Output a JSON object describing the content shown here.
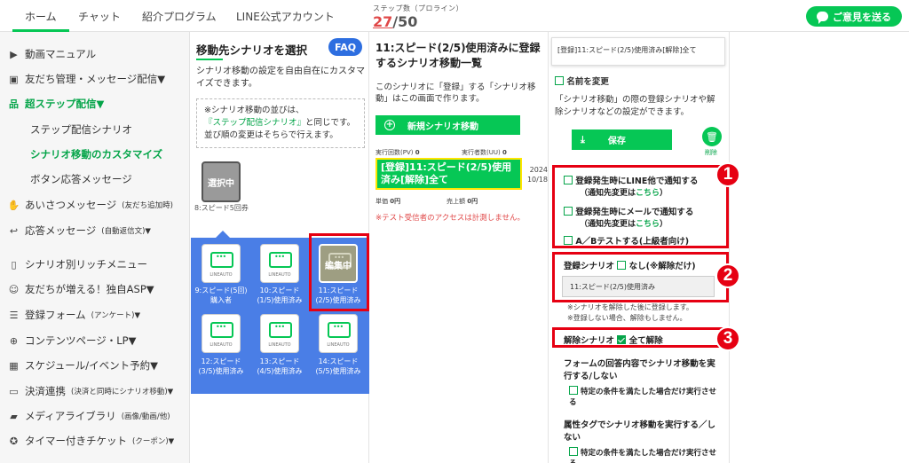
{
  "nav": {
    "tabs": [
      {
        "label": "ホーム"
      },
      {
        "label": "チャット"
      },
      {
        "label": "紹介プログラム"
      },
      {
        "label": "LINE公式アカウント"
      }
    ],
    "step_label": "ステップ数（プロライン）",
    "step_current": "27",
    "step_total": "/50",
    "feedback_label": "ご意見を送る"
  },
  "sidebar": {
    "items": [
      {
        "icon": "video-icon",
        "label": "動画マニュアル"
      },
      {
        "icon": "user-icon",
        "label": "友だち管理・メッセージ配信▼"
      },
      {
        "icon": "sitemap-icon",
        "label": "超ステップ配信▼"
      },
      {
        "icon": "hand-icon",
        "label": "あいさつメッセージ",
        "small": "(友だち追加時)"
      },
      {
        "icon": "reply-icon",
        "label": "応答メッセージ",
        "small": "(自動返信文)▼"
      },
      {
        "icon": "mobile-icon",
        "label": "シナリオ別リッチメニュー"
      },
      {
        "icon": "friends-icon",
        "label": "友だちが増える！独自ASP▼"
      },
      {
        "icon": "list-icon",
        "label": "登録フォーム",
        "small": "(アンケート)▼"
      },
      {
        "icon": "globe-icon",
        "label": "コンテンツページ・LP▼"
      },
      {
        "icon": "calendar-icon",
        "label": "スケジュール/イベント予約▼"
      },
      {
        "icon": "card-icon",
        "label": "決済連携",
        "small": "(決済と同時にシナリオ移動)▼"
      },
      {
        "icon": "folder-icon",
        "label": "メディアライブラリ",
        "small": "(画像/動画/他)"
      },
      {
        "icon": "ticket-icon",
        "label": "タイマー付きチケット",
        "small": "(クーポン)▼"
      }
    ],
    "sub_items": [
      {
        "label": "ステップ配信シナリオ"
      },
      {
        "label": "シナリオ移動のカスタマイズ"
      },
      {
        "label": "ボタン応答メッセージ"
      }
    ]
  },
  "col1": {
    "title": "移動先シナリオを選択",
    "faq_label": "FAQ",
    "desc": "シナリオ移動の設定を自由自在にカスタマイズできます。",
    "note_line1": "※シナリオ移動の並びは、",
    "note_link": "『ステップ配信シナリオ』",
    "note_line2": "と同じです。",
    "note_line3": "並び順の変更はそちらで行えます。",
    "selected_label": "選択中",
    "selected_caption": "8:スピード5回券",
    "brand": "LINEAUTO",
    "editing_label": "編集中",
    "cards": [
      {
        "caption": "9:スピード(5回)購入者"
      },
      {
        "caption": "10:スピード(1/5)使用済み"
      },
      {
        "caption": "11:スピード(2/5)使用済み"
      },
      {
        "caption": "12:スピード(3/5)使用済み"
      },
      {
        "caption": "13:スピード(4/5)使用済み"
      },
      {
        "caption": "14:スピード(5/5)使用済み"
      }
    ]
  },
  "col2": {
    "title": "11:スピード(2/5)使用済みに登録するシナリオ移動一覧",
    "desc": "このシナリオに「登録」する「シナリオ移動」はこの画面で作ります。",
    "new_button": "新規シナリオ移動",
    "stat_runs_label": "実行回数(PV)",
    "stat_runs": "0",
    "stat_users_label": "実行者数(UU)",
    "stat_users": "0",
    "scenario_title": "[登録]11:スピード(2/5)使用済み[解除]全て",
    "scenario_date_year": "2024",
    "scenario_date_md": "10/18",
    "stat_price_label": "単価",
    "stat_price": "0円",
    "stat_sales_label": "売上額",
    "stat_sales": "0円",
    "warning": "※テスト受信者のアクセスは計測しません。"
  },
  "col3": {
    "name_card": "[登録]11:スピード(2/5)使用済み[解除]全て",
    "rename_label": "名前を変更",
    "desc_line1": "「シナリオ移動」の際の登録シナリオや解",
    "desc_line2": "除シナリオなどの設定ができます。",
    "save_label": "保存",
    "delete_label": "削除",
    "opt_line_notify": "登録発生時にLINE他で通知する",
    "opt_line_notify_sub": "（通知先変更は",
    "opt_link": "こちら",
    "opt_close": "）",
    "opt_mail_notify": "登録発生時にメールで通知する",
    "opt_mail_notify_sub": "（通知先変更は",
    "opt_ab": "A／Bテストする(上級者向け)",
    "reg_label": "登録シナリオ",
    "reg_none": "なし(※解除だけ)",
    "reg_select": "11:スピード(2/5)使用済み",
    "reg_note1": "※シナリオを解除した後に登録します。",
    "reg_note2": "※登録しない場合、解除もしません。",
    "release_label": "解除シナリオ",
    "release_all": "全て解除",
    "form_section": "フォームの回答内容でシナリオ移動を実行する/しない",
    "form_opt": "特定の条件を満たした場合だけ実行させる",
    "tag_section": "属性タグでシナリオ移動を実行する／しない",
    "tag_opt": "特定の条件を満たした場合だけ実行させる"
  },
  "badges": [
    "1",
    "2",
    "3"
  ],
  "colors": {
    "accent": "#06c755",
    "highlight": "#e60012",
    "blue": "#4a7ee6"
  }
}
